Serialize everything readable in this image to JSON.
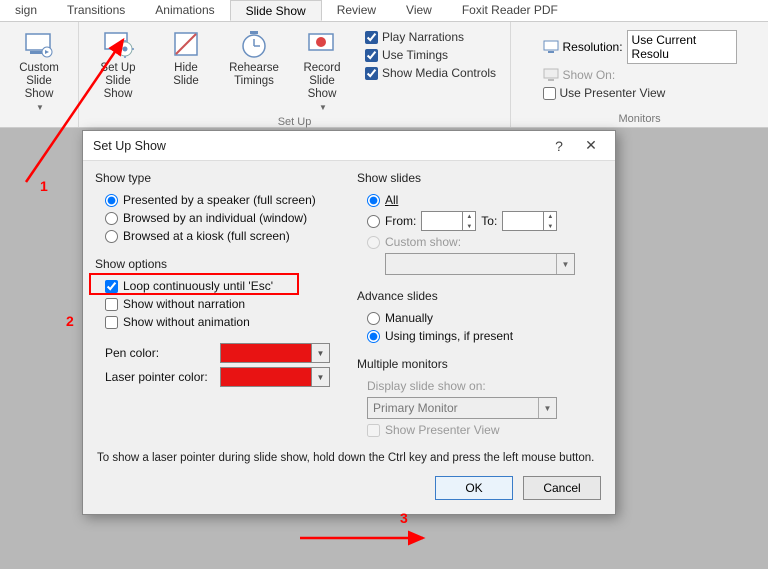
{
  "ribbon": {
    "tabs": [
      "sign",
      "Transitions",
      "Animations",
      "Slide Show",
      "Review",
      "View",
      "Foxit Reader PDF"
    ],
    "active_tab": "Slide Show",
    "buttons": {
      "custom": "Custom\nSlide Show",
      "setup": "Set Up\nSlide Show",
      "hide": "Hide\nSlide",
      "rehearse": "Rehearse\nTimings",
      "record": "Record Slide\nShow"
    },
    "group_label_setup": "Set Up",
    "group_label_monitors": "Monitors",
    "checks": {
      "play_narrations": "Play Narrations",
      "use_timings": "Use Timings",
      "show_media": "Show Media Controls"
    },
    "monitors": {
      "resolution_label": "Resolution:",
      "resolution_value": "Use Current Resolu",
      "show_on_label": "Show On:",
      "presenter": "Use Presenter View"
    }
  },
  "dialog": {
    "title": "Set Up Show",
    "show_type": {
      "title": "Show type",
      "opt1": "Presented by a speaker (full screen)",
      "opt2": "Browsed by an individual (window)",
      "opt3": "Browsed at a kiosk (full screen)"
    },
    "show_options": {
      "title": "Show options",
      "loop": "Loop continuously until 'Esc'",
      "no_narration": "Show without narration",
      "no_animation": "Show without animation",
      "pen_label": "Pen color:",
      "laser_label": "Laser pointer color:"
    },
    "show_slides": {
      "title": "Show slides",
      "all": "All",
      "from": "From:",
      "to": "To:",
      "custom": "Custom show:"
    },
    "advance": {
      "title": "Advance slides",
      "manual": "Manually",
      "timings": "Using timings, if present"
    },
    "multiple_monitors": {
      "title": "Multiple monitors",
      "display_on": "Display slide show on:",
      "monitor_value": "Primary Monitor",
      "presenter": "Show Presenter View"
    },
    "hint": "To show a laser pointer during slide show, hold down the Ctrl key and press the left mouse button.",
    "ok": "OK",
    "cancel": "Cancel"
  },
  "annotations": {
    "n1": "1",
    "n2": "2",
    "n3": "3"
  }
}
